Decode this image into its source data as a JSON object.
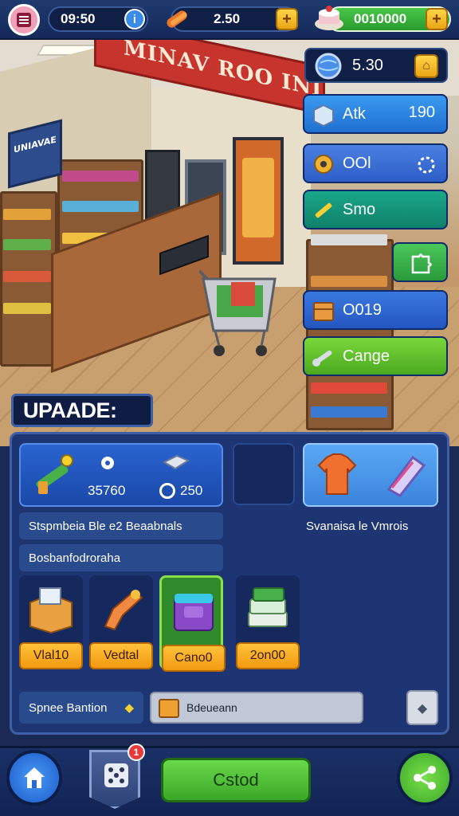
{
  "top_bar": {
    "timer": "09:50",
    "resource_value": "2.50",
    "gem_value": "0010000",
    "menu_icon": "list-icon",
    "info_icon": "info-icon",
    "resource_icon": "sausage-icon",
    "gem_icon": "cake-icon"
  },
  "store": {
    "sign_text": "MINAV ROO INIRU",
    "poster_text": "UNIAVAE"
  },
  "coin_panel": {
    "value": "5.30",
    "icon": "globe-icon",
    "action_icon": "map-icon"
  },
  "side_buttons": [
    {
      "label": "Atk",
      "value": "190",
      "icon": "box-icon",
      "color": "#2f8ae6"
    },
    {
      "label": "OOl",
      "value": "",
      "icon": "tape-icon",
      "color": "#3a6fd6"
    },
    {
      "label": "Smo",
      "value": "",
      "icon": "pencil-icon",
      "color": "#169678"
    },
    {
      "label": "",
      "value": "",
      "icon": "puzzle-icon",
      "color": "#3cb34a"
    },
    {
      "label": "O019",
      "value": "",
      "icon": "crate-icon",
      "color": "#2d62c8"
    },
    {
      "label": "Cange",
      "value": "",
      "icon": "wrench-icon",
      "color": "#5cbf2a"
    }
  ],
  "upgrade": {
    "title": "UPAADE:",
    "card1": {
      "value_a": "35760",
      "value_b": "250"
    },
    "desc_left": "Stspmbeia Ble e2 Beaabnals",
    "desc_right": "Svanaisa le Vmrois",
    "category": "Bosbanfodroraha",
    "items": [
      {
        "label": "Vlal10",
        "icon": "box-open-icon",
        "selected": false
      },
      {
        "label": "Vedtal",
        "icon": "blaster-icon",
        "selected": false
      },
      {
        "label": "Cano0",
        "icon": "bag-icon",
        "selected": true
      },
      {
        "label": "2on00",
        "icon": "stack-icon",
        "selected": false
      }
    ],
    "footer_label": "Spnee Bantion",
    "footer_field": "Bdeueann"
  },
  "bottom_nav": {
    "center_button": "Cstod",
    "notification_count": "1"
  }
}
